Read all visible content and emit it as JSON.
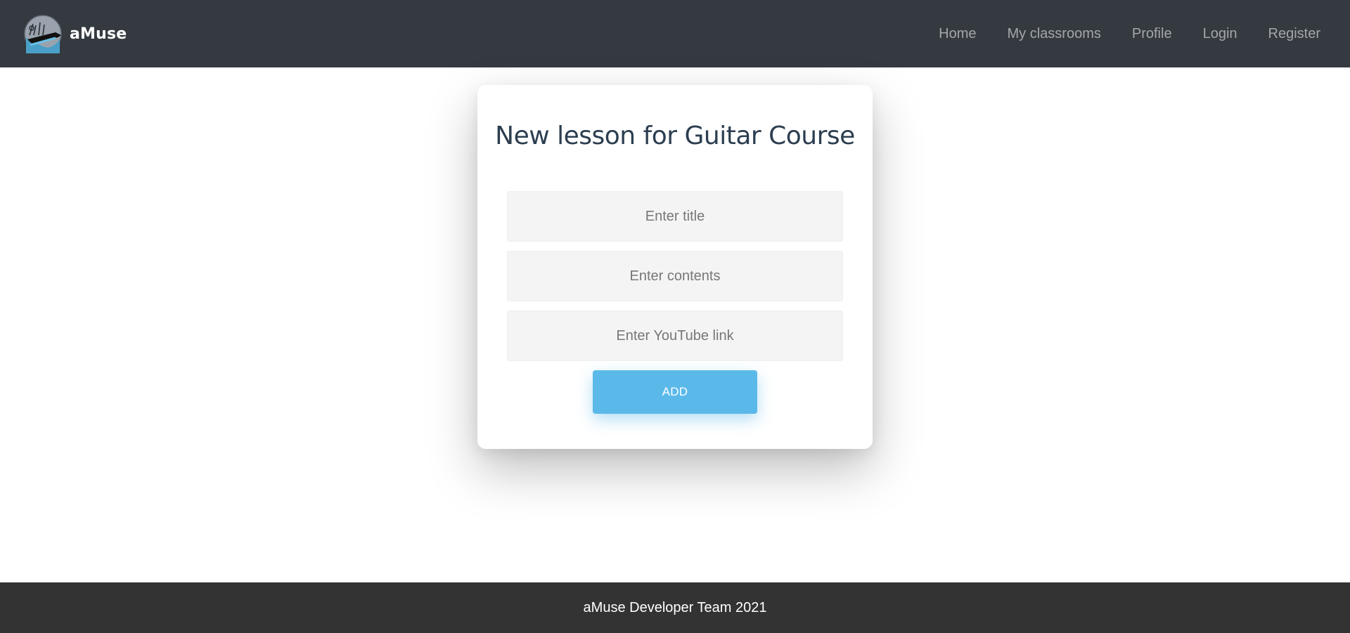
{
  "brand": {
    "name": "aMuse",
    "logo_icon": "amuse-logo"
  },
  "nav": {
    "items": [
      {
        "label": "Home"
      },
      {
        "label": "My classrooms"
      },
      {
        "label": "Profile"
      },
      {
        "label": "Login"
      },
      {
        "label": "Register"
      }
    ]
  },
  "form": {
    "title": "New lesson for Guitar Course",
    "title_field": {
      "value": "",
      "placeholder": "Enter title"
    },
    "contents_field": {
      "value": "",
      "placeholder": "Enter contents"
    },
    "youtube_field": {
      "value": "",
      "placeholder": "Enter YouTube link"
    },
    "submit_label": "ADD"
  },
  "footer": {
    "text": "aMuse Developer Team 2021"
  },
  "colors": {
    "navbar_bg": "#343a40",
    "footer_bg": "#333333",
    "button_accent": "#5bb9ea",
    "title_text": "#2c3e50"
  }
}
